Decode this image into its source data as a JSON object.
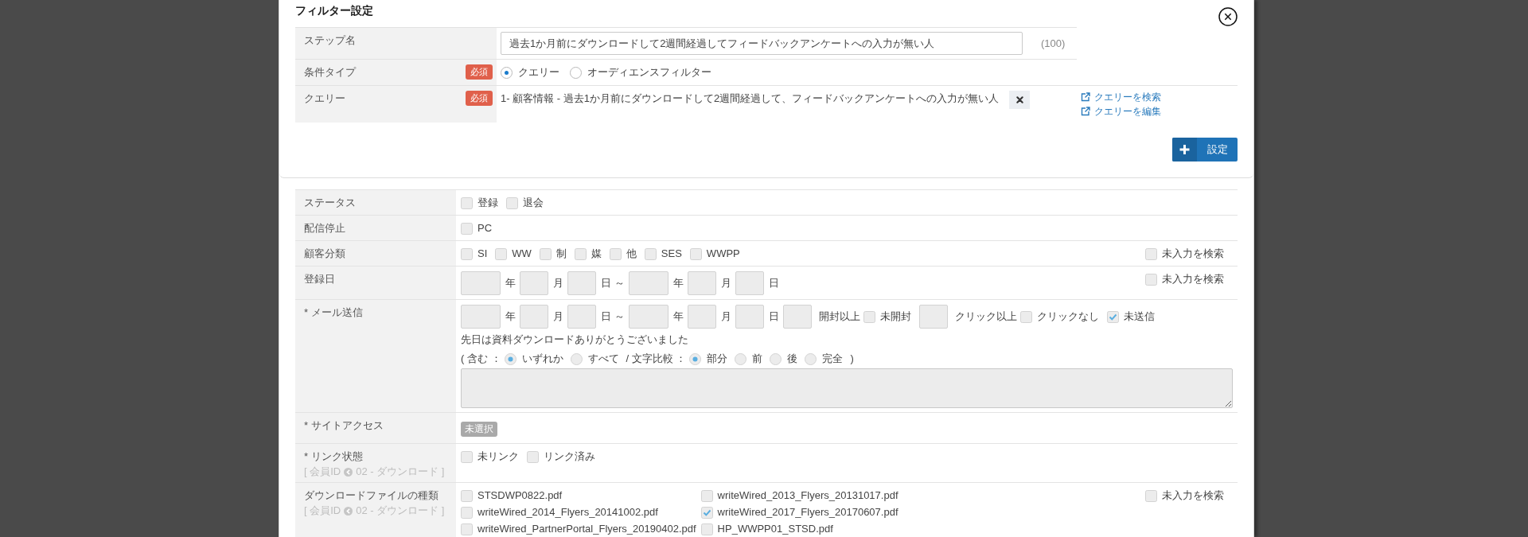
{
  "dialog": {
    "title": "フィルター設定"
  },
  "step_form": {
    "rows": [
      {
        "kind": "text_input",
        "label": "ステップ名",
        "value": "過去1か月前にダウンロードして2週間経過してフィードバックアンケートへの入力が無い人",
        "counter": "(100)"
      },
      {
        "kind": "radio_group",
        "label": "条件タイプ",
        "required": "必須",
        "options": [
          {
            "label": "クエリー",
            "selected": true
          },
          {
            "label": "オーディエンスフィルター",
            "selected": false
          }
        ]
      },
      {
        "kind": "query",
        "label": "クエリー",
        "required": "必須",
        "value": "1- 顧客情報 - 過去1か月前にダウンロードして2週間経過して、フィードバックアンケートへの入力が無い人",
        "links": [
          "クエリーを検索",
          "クエリーを編集"
        ]
      }
    ],
    "submit": {
      "label": "設定"
    }
  },
  "filters": [
    {
      "label": "ステータス",
      "lines": [
        {
          "items": [
            {
              "kind": "checkbox",
              "label": "登録",
              "checked": false
            },
            {
              "kind": "checkbox",
              "label": "退会",
              "checked": false
            }
          ]
        }
      ]
    },
    {
      "label": "配信停止",
      "lines": [
        {
          "items": [
            {
              "kind": "checkbox",
              "label": "PC",
              "checked": false
            }
          ]
        }
      ]
    },
    {
      "label": "顧客分類",
      "lines": [
        {
          "items": [
            {
              "kind": "checkbox",
              "label": "SI",
              "checked": false
            },
            {
              "kind": "checkbox",
              "label": "WW",
              "checked": false
            },
            {
              "kind": "checkbox",
              "label": "制",
              "checked": false
            },
            {
              "kind": "checkbox",
              "label": "媒",
              "checked": false
            },
            {
              "kind": "checkbox",
              "label": "他",
              "checked": false
            },
            {
              "kind": "checkbox",
              "label": "SES",
              "checked": false
            },
            {
              "kind": "checkbox",
              "label": "WWPP",
              "checked": false
            }
          ]
        }
      ],
      "search_empty": {
        "label": "未入力を検索",
        "checked": false
      }
    },
    {
      "label": "登録日",
      "lines": [
        {
          "items": [
            {
              "kind": "date_range",
              "start": {
                "year": "年",
                "month": "月",
                "day": "日"
              },
              "separator": "～",
              "end": {
                "year": "年",
                "month": "月",
                "day": "日"
              }
            }
          ]
        }
      ],
      "search_empty": {
        "label": "未入力を検索",
        "checked": false
      }
    },
    {
      "label": "* メール送信",
      "lines": [
        {
          "items": [
            {
              "kind": "date_range",
              "start": {
                "year": "年",
                "month": "月",
                "day": "日"
              },
              "separator": "～",
              "end": {
                "year": "年",
                "month": "月",
                "day": "日"
              }
            },
            {
              "kind": "count_field",
              "suffix": "開封以上"
            },
            {
              "kind": "checkbox",
              "label": "未開封",
              "checked": false
            },
            {
              "kind": "count_field",
              "suffix": "クリック以上"
            },
            {
              "kind": "checkbox",
              "label": "クリックなし",
              "checked": false
            },
            {
              "kind": "checkbox",
              "label": "未送信",
              "checked": true
            }
          ]
        },
        {
          "items": [
            {
              "kind": "text",
              "text": "先日は資料ダウンロードありがとうございました"
            }
          ]
        },
        {
          "items": [
            {
              "kind": "text",
              "text": "( 含む ："
            },
            {
              "kind": "radio",
              "label": "いずれか",
              "selected": true
            },
            {
              "kind": "radio",
              "label": "すべて",
              "selected": false
            },
            {
              "kind": "text",
              "text": "/ 文字比較 ："
            },
            {
              "kind": "radio",
              "label": "部分",
              "selected": true
            },
            {
              "kind": "radio",
              "label": "前",
              "selected": false
            },
            {
              "kind": "radio",
              "label": "後",
              "selected": false
            },
            {
              "kind": "radio",
              "label": "完全",
              "selected": false
            },
            {
              "kind": "text",
              "text": ")"
            }
          ]
        },
        {
          "items": [
            {
              "kind": "textarea"
            }
          ]
        }
      ]
    },
    {
      "label": "* サイトアクセス",
      "lines": [
        {
          "items": [
            {
              "kind": "tag",
              "label": "未選択"
            }
          ]
        }
      ]
    },
    {
      "label": "* リンク状態",
      "source": {
        "left": "[ 会員ID",
        "right": "02 - ダウンロード ]"
      },
      "lines": [
        {
          "items": [
            {
              "kind": "checkbox",
              "label": "未リンク",
              "checked": false
            },
            {
              "kind": "checkbox",
              "label": "リンク済み",
              "checked": false
            }
          ]
        }
      ]
    },
    {
      "label": "ダウンロードファイルの種類",
      "source": {
        "left": "[ 会員ID",
        "right": "02 - ダウンロード ]"
      },
      "lines": [
        {
          "items": [
            {
              "kind": "checkbox_grid",
              "options": [
                {
                  "label": "STSDWP0822.pdf",
                  "checked": false
                },
                {
                  "label": "writeWired_2013_Flyers_20131017.pdf",
                  "checked": false
                },
                {
                  "label": "writeWired_2014_Flyers_20141002.pdf",
                  "checked": false
                },
                {
                  "label": "writeWired_2017_Flyers_20170607.pdf",
                  "checked": true
                },
                {
                  "label": "writeWired_PartnerPortal_Flyers_20190402.pdf",
                  "checked": false
                },
                {
                  "label": "HP_WWPP01_STSD.pdf",
                  "checked": false
                }
              ]
            }
          ]
        }
      ],
      "search_empty": {
        "label": "未入力を検索",
        "checked": false
      }
    }
  ]
}
